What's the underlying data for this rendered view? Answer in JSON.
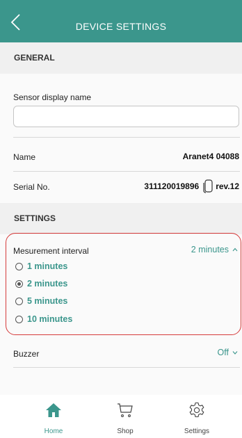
{
  "header": {
    "title": "DEVICE SETTINGS"
  },
  "general": {
    "section_label": "GENERAL",
    "display_name_label": "Sensor display name",
    "display_name_value": "",
    "name_label": "Name",
    "name_value": "Aranet4 04088",
    "serial_label": "Serial No.",
    "serial_value": "311120019896",
    "revision": "rev.12"
  },
  "settings": {
    "section_label": "SETTINGS",
    "interval_label": "Mesurement interval",
    "interval_value": "2 minutes",
    "options": [
      {
        "label": "1 minutes",
        "selected": false
      },
      {
        "label": "2 minutes",
        "selected": true
      },
      {
        "label": "5 minutes",
        "selected": false
      },
      {
        "label": "10 minutes",
        "selected": false
      }
    ],
    "buzzer_label": "Buzzer",
    "buzzer_value": "Off"
  },
  "nav": {
    "items": [
      {
        "label": "Home",
        "icon": "home-icon",
        "active": true
      },
      {
        "label": "Shop",
        "icon": "cart-icon",
        "active": false
      },
      {
        "label": "Settings",
        "icon": "gear-icon",
        "active": false
      }
    ]
  },
  "colors": {
    "accent": "#3b968c",
    "highlight": "#d53a3a",
    "header": "#3b968c"
  }
}
